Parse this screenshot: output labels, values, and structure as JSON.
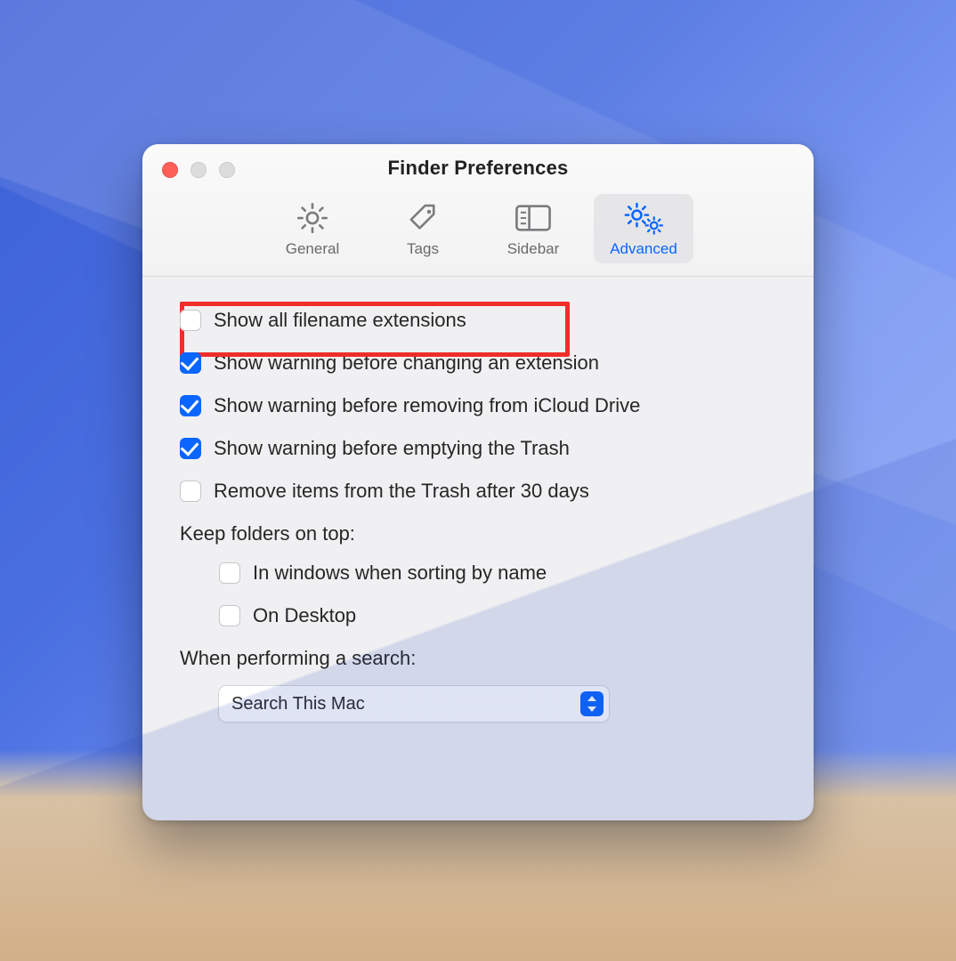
{
  "window": {
    "title": "Finder Preferences"
  },
  "tabs": {
    "general": {
      "label": "General"
    },
    "tags": {
      "label": "Tags"
    },
    "sidebar": {
      "label": "Sidebar"
    },
    "advanced": {
      "label": "Advanced",
      "active": true
    }
  },
  "options": {
    "show_extensions": {
      "label": "Show all filename extensions",
      "checked": false,
      "highlighted": true
    },
    "warn_change_extension": {
      "label": "Show warning before changing an extension",
      "checked": true
    },
    "warn_icloud_remove": {
      "label": "Show warning before removing from iCloud Drive",
      "checked": true
    },
    "warn_empty_trash": {
      "label": "Show warning before emptying the Trash",
      "checked": true
    },
    "auto_empty_trash": {
      "label": "Remove items from the Trash after 30 days",
      "checked": false
    }
  },
  "folders_on_top": {
    "heading": "Keep folders on top:",
    "in_windows": {
      "label": "In windows when sorting by name",
      "checked": false
    },
    "on_desktop": {
      "label": "On Desktop",
      "checked": false
    }
  },
  "search": {
    "heading": "When performing a search:",
    "selected": "Search This Mac"
  }
}
